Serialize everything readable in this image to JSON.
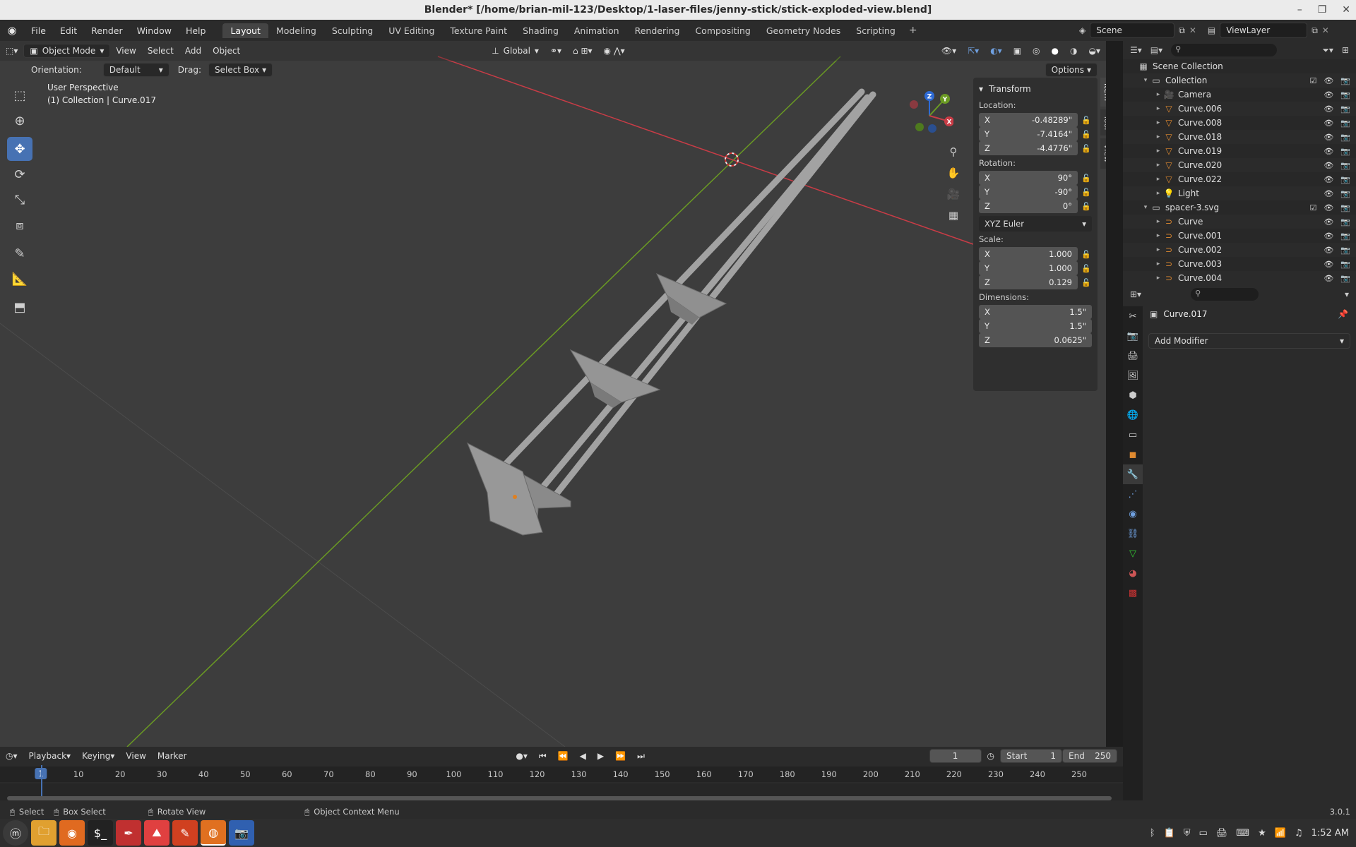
{
  "window": {
    "title": "Blender* [/home/brian-mil-123/Desktop/1-laser-files/jenny-stick/stick-exploded-view.blend]"
  },
  "menu": [
    "File",
    "Edit",
    "Render",
    "Window",
    "Help"
  ],
  "workspaces": [
    "Layout",
    "Modeling",
    "Sculpting",
    "UV Editing",
    "Texture Paint",
    "Shading",
    "Animation",
    "Rendering",
    "Compositing",
    "Geometry Nodes",
    "Scripting"
  ],
  "active_workspace": "Layout",
  "scene_name": "Scene",
  "view_layer": "ViewLayer",
  "viewport": {
    "mode": "Object Mode",
    "menus": [
      "View",
      "Select",
      "Add",
      "Object"
    ],
    "transform_orientation": "Global",
    "orientation_label": "Orientation:",
    "orientation_value": "Default",
    "drag_label": "Drag:",
    "drag_value": "Select Box",
    "options": "Options",
    "info_line1": "User Perspective",
    "info_line2": "(1) Collection | Curve.017"
  },
  "npanel": {
    "title": "Transform",
    "location_label": "Location:",
    "location": {
      "x": "-0.48289\"",
      "y": "-7.4164\"",
      "z": "-4.4776\""
    },
    "rotation_label": "Rotation:",
    "rotation": {
      "x": "90°",
      "y": "-90°",
      "z": "0°"
    },
    "rotation_mode": "XYZ Euler",
    "scale_label": "Scale:",
    "scale": {
      "x": "1.000",
      "y": "1.000",
      "z": "0.129"
    },
    "dimensions_label": "Dimensions:",
    "dimensions": {
      "x": "1.5\"",
      "y": "1.5\"",
      "z": "0.0625\""
    },
    "tabs": [
      "Item",
      "Tool",
      "View"
    ]
  },
  "outliner": {
    "rows": [
      {
        "name": "Scene Collection",
        "indent": 0,
        "icon": "scene-collection-icon"
      },
      {
        "name": "Collection",
        "indent": 1,
        "icon": "collection-icon"
      },
      {
        "name": "Camera",
        "indent": 2,
        "icon": "camera-icon"
      },
      {
        "name": "Curve.006",
        "indent": 2,
        "icon": "mesh-icon"
      },
      {
        "name": "Curve.008",
        "indent": 2,
        "icon": "mesh-icon"
      },
      {
        "name": "Curve.018",
        "indent": 2,
        "icon": "mesh-icon"
      },
      {
        "name": "Curve.019",
        "indent": 2,
        "icon": "mesh-icon"
      },
      {
        "name": "Curve.020",
        "indent": 2,
        "icon": "mesh-icon"
      },
      {
        "name": "Curve.022",
        "indent": 2,
        "icon": "mesh-icon"
      },
      {
        "name": "Light",
        "indent": 2,
        "icon": "light-icon"
      },
      {
        "name": "spacer-3.svg",
        "indent": 1,
        "icon": "collection-icon"
      },
      {
        "name": "Curve",
        "indent": 2,
        "icon": "curve-icon"
      },
      {
        "name": "Curve.001",
        "indent": 2,
        "icon": "curve-icon"
      },
      {
        "name": "Curve.002",
        "indent": 2,
        "icon": "curve-icon"
      },
      {
        "name": "Curve.003",
        "indent": 2,
        "icon": "curve-icon"
      },
      {
        "name": "Curve.004",
        "indent": 2,
        "icon": "curve-icon"
      }
    ]
  },
  "properties": {
    "object_name": "Curve.017",
    "add_modifier": "Add Modifier"
  },
  "timeline": {
    "menus": [
      "Playback",
      "Keying",
      "View",
      "Marker"
    ],
    "current_frame": "1",
    "start_label": "Start",
    "start": "1",
    "end_label": "End",
    "end": "250",
    "ticks": [
      "1",
      "10",
      "20",
      "30",
      "40",
      "50",
      "60",
      "70",
      "80",
      "90",
      "100",
      "110",
      "120",
      "130",
      "140",
      "150",
      "160",
      "170",
      "180",
      "190",
      "200",
      "210",
      "220",
      "230",
      "240",
      "250"
    ]
  },
  "statusbar": {
    "select": "Select",
    "box_select": "Box Select",
    "rotate": "Rotate View",
    "context_menu": "Object Context Menu",
    "version": "3.0.1"
  },
  "taskbar": {
    "time": "1:52 AM"
  },
  "colors": {
    "accent": "#4772b3",
    "x_axis": "#c83c46",
    "y_axis": "#6a9a23"
  }
}
